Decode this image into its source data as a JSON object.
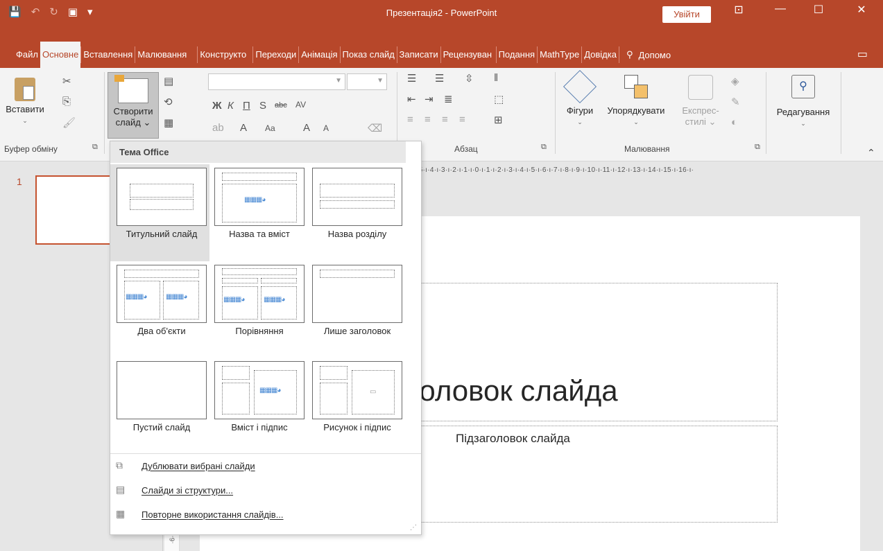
{
  "window": {
    "title": "Презентація2 - PowerPoint",
    "signin": "Увійти",
    "minimize_glyph": "—",
    "maximize_glyph": "☐",
    "close_glyph": "✕"
  },
  "qat": {
    "save_glyph": "💾",
    "undo_glyph": "↶",
    "redo_glyph": "↻",
    "present_glyph": "▣",
    "more_glyph": "▾"
  },
  "tabs": [
    {
      "label": "Файл"
    },
    {
      "label": "Основне"
    },
    {
      "label": "Вставлення"
    },
    {
      "label": "Малювання"
    },
    {
      "label": "Конструкто"
    },
    {
      "label": "Переходи"
    },
    {
      "label": "Анімація"
    },
    {
      "label": "Показ слайд"
    },
    {
      "label": "Записати"
    },
    {
      "label": "Рецензуван"
    },
    {
      "label": "Подання"
    },
    {
      "label": "MathType"
    },
    {
      "label": "Довідка"
    }
  ],
  "tellme": {
    "label": "Допомо",
    "icon": "💡"
  },
  "ribbon": {
    "paste_label": "Вставити",
    "clipboard_group": "Буфер обміну",
    "new_slide_label1": "Створити",
    "new_slide_label2": "слайд",
    "paragraph_group": "Абзац",
    "drawing_group": "Малювання",
    "shapes_label": "Фігури",
    "arrange_label": "Упорядкувати",
    "quickstyles_label1": "Експрес-",
    "quickstyles_label2": "стилі",
    "editing_label": "Редагування",
    "font_letters": {
      "bold": "Ж",
      "italic": "К",
      "underline": "П",
      "strike": "S",
      "strike_small": "abc",
      "spacing": "AV",
      "grow": "A",
      "shrink": "A",
      "case": "Aa",
      "color": "A"
    }
  },
  "dropdown": {
    "header": "Тема Office",
    "layouts": [
      {
        "name": "Титульний слайд"
      },
      {
        "name": "Назва та вміст"
      },
      {
        "name": "Назва розділу"
      },
      {
        "name": "Два об'єкти"
      },
      {
        "name": "Порівняння"
      },
      {
        "name": "Лише заголовок"
      },
      {
        "name": "Пустий слайд"
      },
      {
        "name": "Вміст і підпис"
      },
      {
        "name": "Рисунок і підпис"
      }
    ],
    "actions": [
      {
        "label": "Дублювати вибрані слайди"
      },
      {
        "label": "Слайди зі структури..."
      },
      {
        "label": "Повторне використання слайдів..."
      }
    ]
  },
  "slides_pane": {
    "number": "1"
  },
  "ruler": {
    "horizontal": "·5·ı·4·ı·3·ı·2·ı·1·ı·0·ı·1·ı·2·ı·3·ı·4·ı·5·ı·6·ı·7·ı·8·ı·9·ı·10·ı·11·ı·12·ı·13·ı·14·ı·15·ı·16·ı·",
    "vertical": "·6·"
  },
  "slide": {
    "title": "головок слайда",
    "subtitle": "Підзаголовок слайда"
  },
  "colors": {
    "accent": "#b7472a",
    "ribbon_bg": "#f3f3f3",
    "canvas_bg": "#e6e6e6"
  }
}
